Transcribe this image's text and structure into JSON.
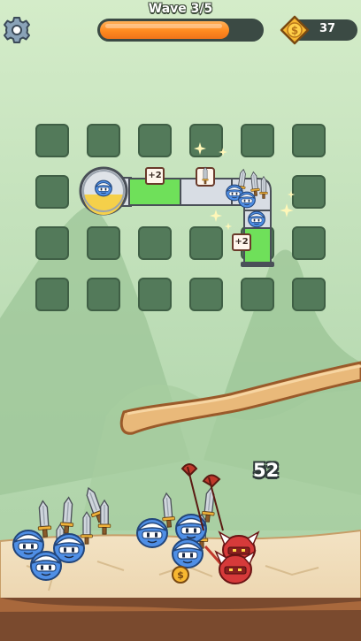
{
  "hud": {
    "wave_label": "Wave 3/5",
    "wave_progress": 0.8,
    "coin_count": "37"
  },
  "board": {
    "rows": 4,
    "cols": 6,
    "path_bonus_1": "+2",
    "path_bonus_2": "+2"
  },
  "battle": {
    "damage_popup": "52",
    "bonus_coin_symbol": "$"
  },
  "icons": {
    "settings": "gear-icon",
    "currency": "coin-icon",
    "spawner": "spawner-portal-icon",
    "weapon": "sword-icon",
    "sparkle": "sparkle-icon"
  },
  "colors": {
    "sky_top": "#cfe9c6",
    "sky_bottom": "#b6d8b1",
    "grid_cell": "#537a5a",
    "progress_fill": "#ff8a1f",
    "coin_gold": "#f7b731",
    "ally_blue": "#4f8fe6",
    "enemy_red": "#d63a3a",
    "path_green": "#6fe05a",
    "ground": "#f0dfbf"
  }
}
